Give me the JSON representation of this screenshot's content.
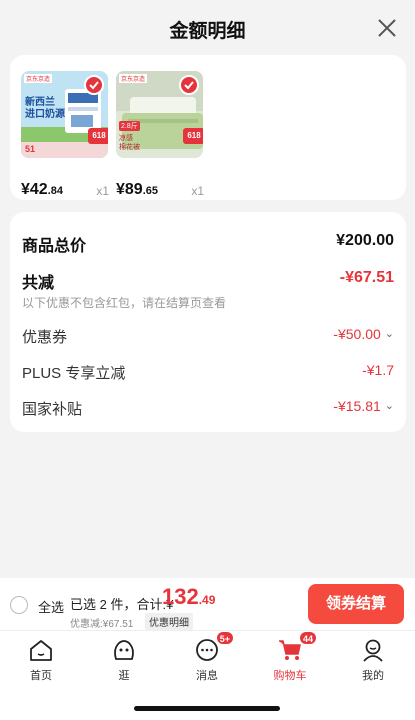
{
  "header": {
    "title": "金额明细"
  },
  "products": [
    {
      "image_text": [
        "京东京造",
        "新西兰",
        "进口奶源"
      ],
      "price_main": "¥42",
      "price_decimal": ".84",
      "qty": "x1",
      "badge": "618",
      "strip_text": "51"
    },
    {
      "image_text": [
        "京东京造",
        "2.8斤",
        "凉感",
        "棉花被"
      ],
      "price_main": "¥89",
      "price_decimal": ".65",
      "qty": "x1",
      "badge": "618"
    }
  ],
  "summary": {
    "total_label": "商品总价",
    "total_value": "¥200.00",
    "discount_label": "共减",
    "discount_value": "-¥67.51",
    "note": "以下优惠不包含红包，请在结算页查看",
    "items": [
      {
        "label": "优惠券",
        "value": "-¥50.00",
        "chevron": "⌄"
      },
      {
        "label": "PLUS 专享立减",
        "value": "-¥1.7",
        "chevron": ""
      },
      {
        "label": "国家补贴",
        "value": "-¥15.81",
        "chevron": "⌄"
      }
    ]
  },
  "bottom_bar": {
    "select_all": "全选",
    "selected": "已选 2 件，合计:¥",
    "amount_main": "132",
    "amount_decimal": ".49",
    "discount_line": "优惠减:¥67.51",
    "detail_link": "优惠明细",
    "checkout_label": "领券结算"
  },
  "tabs": [
    {
      "label": "首页",
      "icon": "home-icon"
    },
    {
      "label": "逛",
      "icon": "browse-icon"
    },
    {
      "label": "消息",
      "icon": "message-icon",
      "badge": "5+"
    },
    {
      "label": "购物车",
      "icon": "cart-icon",
      "badge": "44"
    },
    {
      "label": "我的",
      "icon": "profile-icon"
    }
  ],
  "colors": {
    "accent": "#e5343b",
    "button": "#f54a3e"
  }
}
